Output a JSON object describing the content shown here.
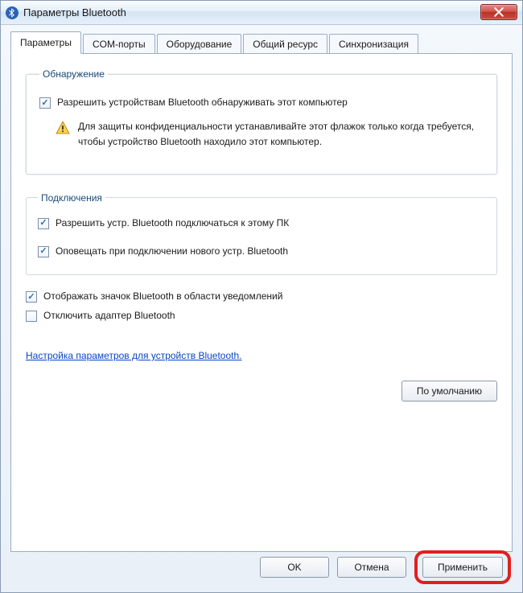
{
  "window": {
    "title": "Параметры Bluetooth"
  },
  "tabs": [
    {
      "label": "Параметры"
    },
    {
      "label": "COM-порты"
    },
    {
      "label": "Оборудование"
    },
    {
      "label": "Общий ресурс"
    },
    {
      "label": "Синхронизация"
    }
  ],
  "groups": {
    "discovery": {
      "legend": "Обнаружение",
      "allow_label": "Разрешить устройствам Bluetooth обнаруживать этот компьютер",
      "allow_checked": true,
      "warning": "Для защиты конфиденциальности устанавливайте этот флажок только когда требуется, чтобы устройство Bluetooth находило этот компьютер."
    },
    "connections": {
      "legend": "Подключения",
      "allow_connect_label": "Разрешить устр. Bluetooth подключаться к этому ПК",
      "allow_connect_checked": true,
      "notify_label": "Оповещать при подключении нового устр. Bluetooth",
      "notify_checked": true
    }
  },
  "options": {
    "show_tray_label": "Отображать значок Bluetooth в области уведомлений",
    "show_tray_checked": true,
    "disable_adapter_label": "Отключить адаптер Bluetooth",
    "disable_adapter_checked": false
  },
  "link_text": "Настройка параметров для устройств Bluetooth.",
  "buttons": {
    "defaults": "По умолчанию",
    "ok": "OK",
    "cancel": "Отмена",
    "apply": "Применить"
  }
}
